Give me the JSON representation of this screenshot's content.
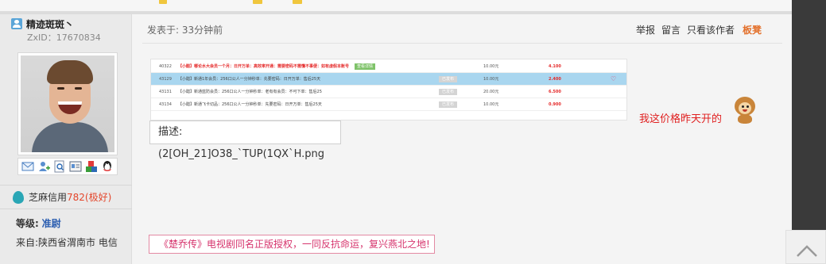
{
  "user": {
    "name": "精迹斑斑丶",
    "zxid": "ZxID：17670834",
    "credit_label": "芝麻信用",
    "credit_score": "782(极好)",
    "level_label": "等级:",
    "level_value": "准尉",
    "from": "来自:陕西省渭南市 电信"
  },
  "post": {
    "posted_at": "发表于: 33分钟前",
    "actions": [
      "举报",
      "留言",
      "只看该作者"
    ],
    "floor": "板凳",
    "caption": "描述:(2[OH_21]O38_`TUP(1QX`H.png",
    "reply_text": "我这价格昨天开的",
    "banner": "《楚乔传》电视剧同名正版授权，一同反抗命运，复兴燕北之地!"
  },
  "screenshot_rows": [
    {
      "id": "40322",
      "desc": "【小醋】哪论水大会员一个月：日开万单：高效率开通：需要密码不需懂不事便：如有虚假本账号",
      "badge": "查看详情",
      "status": "",
      "price": "10.00元",
      "num": "4.100",
      "highlight": false,
      "red": true
    },
    {
      "id": "43129",
      "desc": "【小醋】新通1年会员：256口公人一分钟秒单：先要密码：日开万单：售后25天",
      "badge": "",
      "status": "已发布",
      "price": "10.00元",
      "num": "2.400",
      "highlight": true,
      "red": false
    },
    {
      "id": "43131",
      "desc": "【小醋】新通蓝防会员：256口公人一分钟秒单：老有有会员：不可下单：售后25",
      "badge": "",
      "status": "已发布",
      "price": "20.00元",
      "num": "6.500",
      "highlight": false,
      "red": false
    },
    {
      "id": "43134",
      "desc": "【小醋】新通飞卡切品：256口公人一分钟秒单：先要密码：日开万单：售后25天",
      "badge": "",
      "status": "已发布",
      "price": "10.00元",
      "num": "0.900",
      "highlight": false,
      "red": false
    }
  ],
  "icons": {
    "user": "user-badge-icon",
    "credit": "sesame-credit-icon",
    "actions": [
      "mail-icon",
      "add-friend-icon",
      "search-icon",
      "profile-card-icon",
      "blocks-icon",
      "qq-icon"
    ],
    "emoji": "monkey-emoji-icon",
    "back_to_top": "chevron-up-icon"
  },
  "colors": {
    "accent_orange": "#e3702b",
    "credit_red": "#e4462b",
    "level_blue": "#2a5db0",
    "reply_red": "#e01f1f",
    "banner_pink": "#d6336c"
  }
}
